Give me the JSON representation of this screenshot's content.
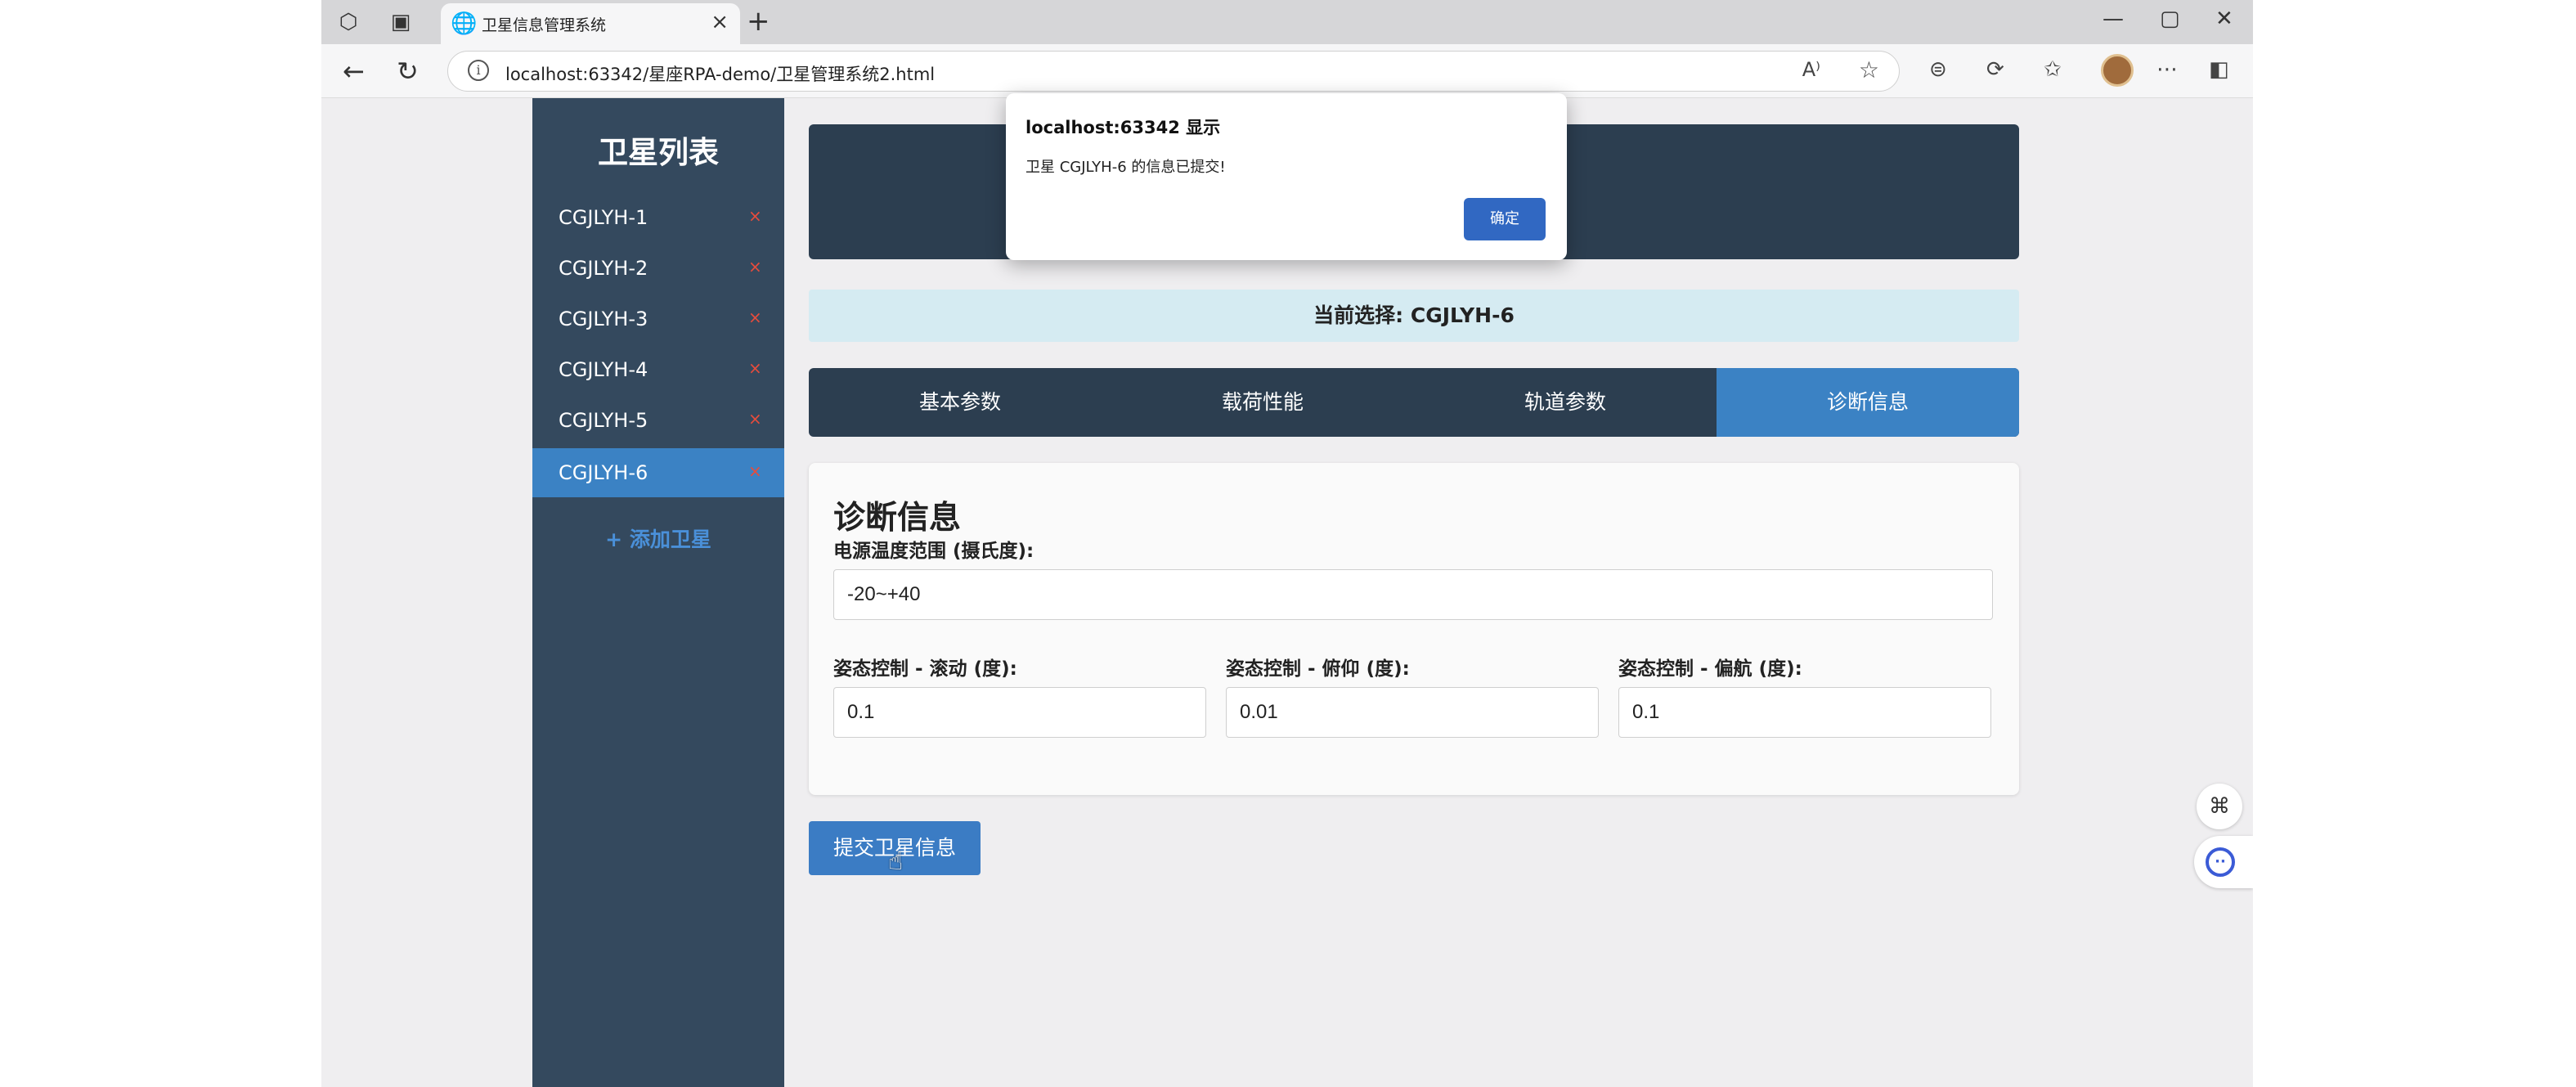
{
  "browser": {
    "tab_title": "卫星信息管理系统",
    "url": "localhost:63342/星座RPA-demo/卫星管理系统2.html",
    "new_tab_label": "+",
    "tab_close": "×"
  },
  "sidebar": {
    "title": "卫星列表",
    "items": [
      {
        "label": "CGJLYH-1",
        "delete": "×",
        "active": false
      },
      {
        "label": "CGJLYH-2",
        "delete": "×",
        "active": false
      },
      {
        "label": "CGJLYH-3",
        "delete": "×",
        "active": false
      },
      {
        "label": "CGJLYH-4",
        "delete": "×",
        "active": false
      },
      {
        "label": "CGJLYH-5",
        "delete": "×",
        "active": false
      },
      {
        "label": "CGJLYH-6",
        "delete": "×",
        "active": true
      }
    ],
    "add_label": "+ 添加卫星"
  },
  "current_selection": "当前选择: CGJLYH-6",
  "tabs": [
    {
      "label": "基本参数",
      "active": false
    },
    {
      "label": "载荷性能",
      "active": false
    },
    {
      "label": "轨道参数",
      "active": false
    },
    {
      "label": "诊断信息",
      "active": true
    }
  ],
  "form": {
    "title": "诊断信息",
    "power_temp_label": "电源温度范围 (摄氏度):",
    "power_temp_value": "-20~+40",
    "roll_label": "姿态控制 - 滚动 (度):",
    "roll_value": "0.1",
    "pitch_label": "姿态控制 - 俯仰 (度):",
    "pitch_value": "0.01",
    "yaw_label": "姿态控制 - 偏航 (度):",
    "yaw_value": "0.1"
  },
  "submit_label": "提交卫星信息",
  "dialog": {
    "title": "localhost:63342 显示",
    "message": "卫星 CGJLYH-6 的信息已提交!",
    "ok_label": "确定"
  },
  "colors": {
    "sidebar": "#34495e",
    "accent": "#3b82c4",
    "header": "#2c3e50",
    "delete": "#e74c3c"
  }
}
